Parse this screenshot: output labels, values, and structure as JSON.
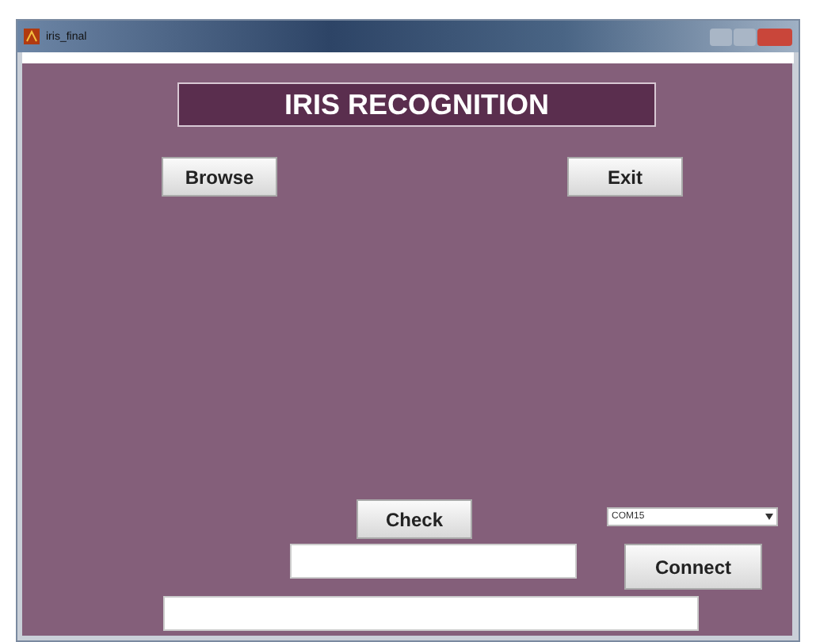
{
  "window": {
    "title": "iris_final"
  },
  "heading": "IRIS RECOGNITION",
  "buttons": {
    "browse": "Browse",
    "exit": "Exit",
    "check": "Check",
    "connect": "Connect"
  },
  "port_select": {
    "value": "COM15"
  }
}
